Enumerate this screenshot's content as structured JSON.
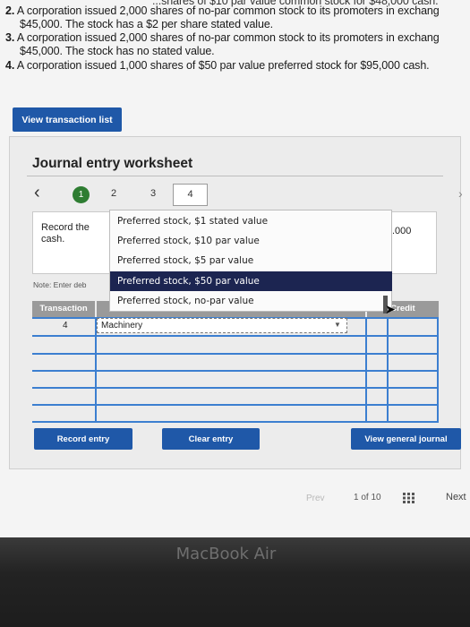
{
  "questions": [
    {
      "num": "2.",
      "line1": "A corporation issued 2,000 shares of no-par common stock to its promoters in exchang",
      "line2": "$45,000. The stock has a $2 per share stated value."
    },
    {
      "num": "3.",
      "line1": "A corporation issued 2,000 shares of no-par common stock to its promoters in exchang",
      "line2": "$45,000. The stock has no stated value."
    },
    {
      "num": "4.",
      "line1": "A corporation issued 1,000 shares of $50 par value preferred stock for $95,000 cash."
    }
  ],
  "top_clipped": "...shares of $10 par value common stock for $48,000 cash.",
  "view_transaction_list": "View transaction list",
  "worksheet": {
    "title": "Journal entry worksheet",
    "steps": [
      "1",
      "2",
      "3",
      "4"
    ],
    "record_text": "Record the cash.",
    "amount_text": ".000",
    "note_text": "Note: Enter deb"
  },
  "dropdown": {
    "options": [
      "Preferred stock, $1 stated value",
      "Preferred stock, $10 par value",
      "Preferred stock, $5 par value",
      "Preferred stock, $50 par value",
      "Preferred stock, no-par value"
    ],
    "selected": "Preferred stock, $50 par value"
  },
  "table": {
    "headers": {
      "transaction": "Transaction",
      "credit": "Credit"
    },
    "row1": {
      "transaction": "4",
      "account": "Machinery"
    }
  },
  "buttons": {
    "record_entry": "Record entry",
    "clear_entry": "Clear entry",
    "view_general_journal": "View general journal"
  },
  "pagination": {
    "prev": "Prev",
    "current": "1",
    "of": "of",
    "total": "10",
    "next": "Next"
  },
  "bezel_label": "MacBook Air"
}
